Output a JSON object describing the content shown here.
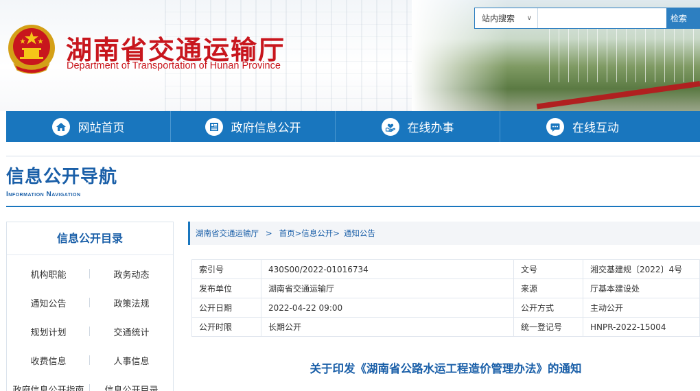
{
  "header": {
    "title": "湖南省交通运输厅",
    "subtitle": "Department of Transportation of Hunan Province",
    "colors": {
      "brand_red": "#c8161d",
      "brand_blue": "#1976be"
    }
  },
  "search": {
    "scope": "站内搜索",
    "placeholder": "",
    "button_label": "检索"
  },
  "nav": {
    "items": [
      {
        "label": "网站首页",
        "icon": "home-icon"
      },
      {
        "label": "政府信息公开",
        "icon": "document-icon"
      },
      {
        "label": "在线办事",
        "icon": "hand-heart-icon"
      },
      {
        "label": "在线互动",
        "icon": "chat-icon"
      }
    ]
  },
  "section": {
    "title_cn": "信息公开导航",
    "title_en": "Information Navigation"
  },
  "sidebar": {
    "title": "信息公开目录",
    "items": [
      "机构职能",
      "政务动态",
      "通知公告",
      "政策法规",
      "规划计划",
      "交通统计",
      "收费信息",
      "人事信息",
      "政府信息公开指南",
      "信息公开目录"
    ]
  },
  "breadcrumb": {
    "root": "湖南省交通运输厅",
    "separator": ">",
    "path": "首页>信息公开>",
    "current": "通知公告"
  },
  "info_table": {
    "rows": [
      [
        "索引号",
        "430S00/2022-01016734",
        "文号",
        "湘交基建规〔2022〕4号"
      ],
      [
        "发布单位",
        "湖南省交通运输厅",
        "来源",
        "厅基本建设处"
      ],
      [
        "公开日期",
        "2022-04-22 09:00",
        "公开方式",
        "主动公开"
      ],
      [
        "公开时限",
        "长期公开",
        "统一登记号",
        "HNPR-2022-15004"
      ]
    ]
  },
  "notice": {
    "title": "关于印发《湖南省公路水运工程造价管理办法》的通知"
  }
}
